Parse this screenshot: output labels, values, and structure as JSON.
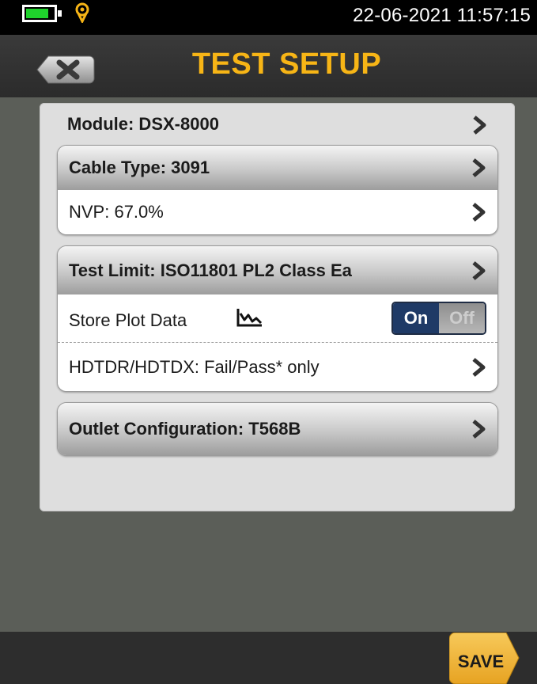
{
  "status_bar": {
    "datetime": "22-06-2021 11:57:15",
    "battery_icon": "battery-icon",
    "location_icon": "location-pin-icon",
    "battery_color": "#1fd22c"
  },
  "header": {
    "title": "TEST SETUP",
    "back_icon": "close-x-icon",
    "title_color": "#f7b516"
  },
  "settings": {
    "module_label": "Module: DSX-8000",
    "cable_type_label": "Cable Type: 3091",
    "nvp_label": "NVP: 67.0%",
    "test_limit_label": "Test Limit: ISO11801 PL2 Class Ea",
    "store_plot_label": "Store Plot Data",
    "store_plot_icon": "plot-graph-icon",
    "store_plot_on": "On",
    "store_plot_off": "Off",
    "store_plot_value": "On",
    "hdtdr_label": "HDTDR/HDTDX: Fail/Pass* only",
    "outlet_label": "Outlet Configuration: T568B"
  },
  "footer": {
    "save_label": "SAVE",
    "save_color": "#f2b83a"
  }
}
